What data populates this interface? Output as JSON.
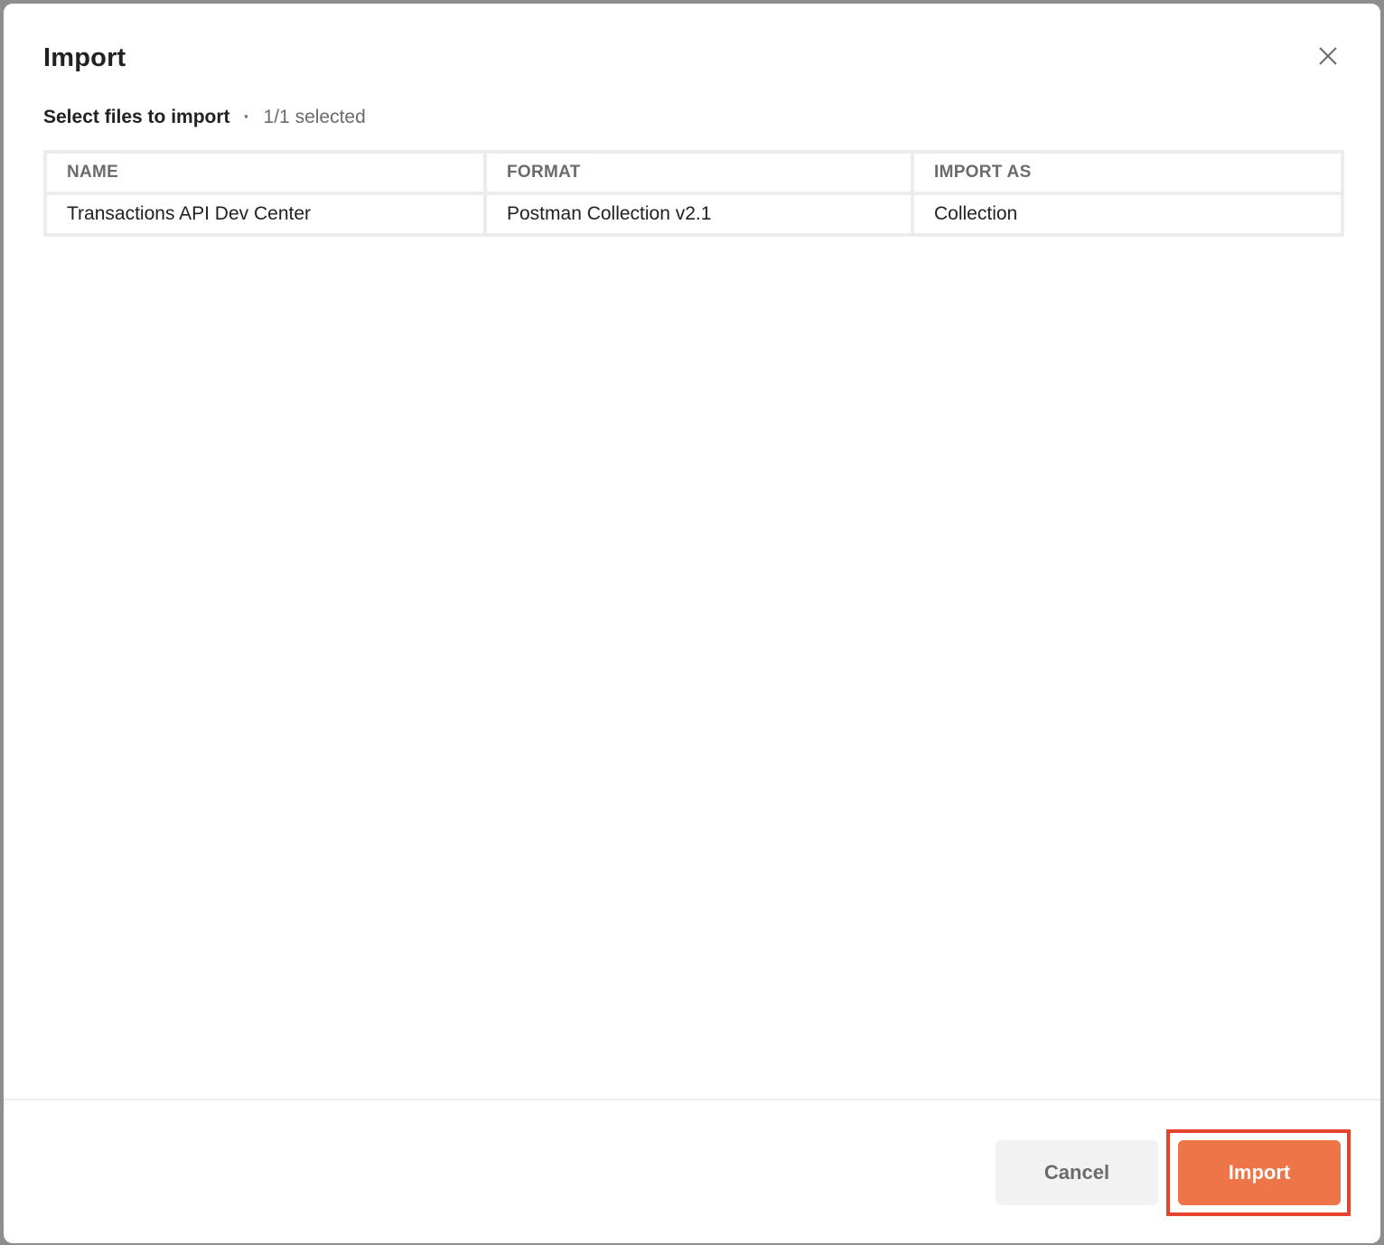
{
  "dialog": {
    "title": "Import",
    "close_icon": "close-icon",
    "subheader": {
      "label": "Select files to import",
      "separator": "·",
      "selection_count": "1/1 selected"
    },
    "table": {
      "columns": [
        "NAME",
        "FORMAT",
        "IMPORT AS"
      ],
      "rows": [
        {
          "name": "Transactions API Dev Center",
          "format": "Postman Collection v2.1",
          "import_as": "Collection"
        }
      ]
    },
    "footer": {
      "cancel_label": "Cancel",
      "import_label": "Import"
    }
  },
  "colors": {
    "primary_button": "#ed7547",
    "secondary_button": "#f2f2f2",
    "highlight_outline": "#e5432c",
    "backdrop": "#8d8d8d"
  }
}
